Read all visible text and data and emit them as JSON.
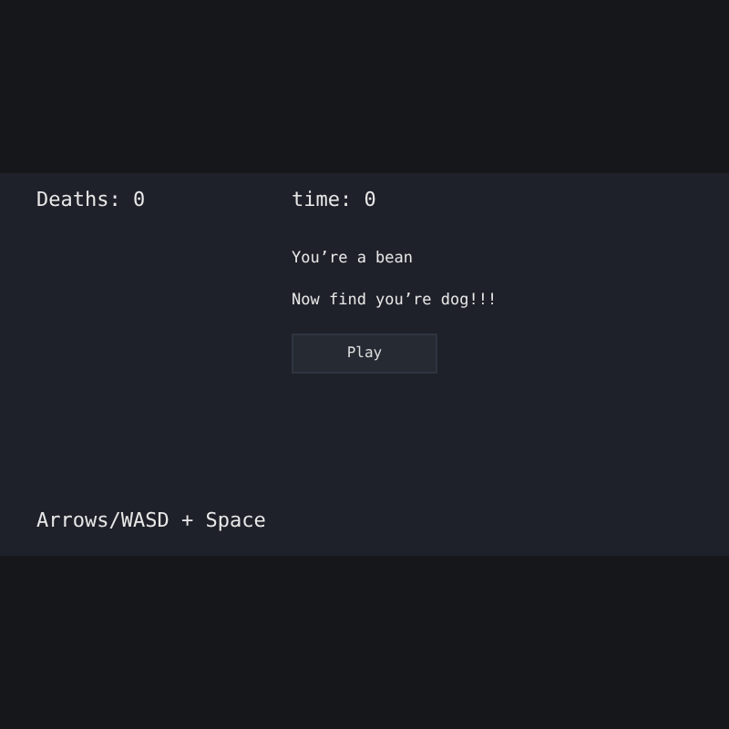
{
  "hud": {
    "deaths": "Deaths: 0",
    "time": "time: 0"
  },
  "intro": [
    "You’re a bean",
    "Now find you’re dog!!!"
  ],
  "play_button": "Play",
  "controls_hint": "Arrows/WASD + Space"
}
